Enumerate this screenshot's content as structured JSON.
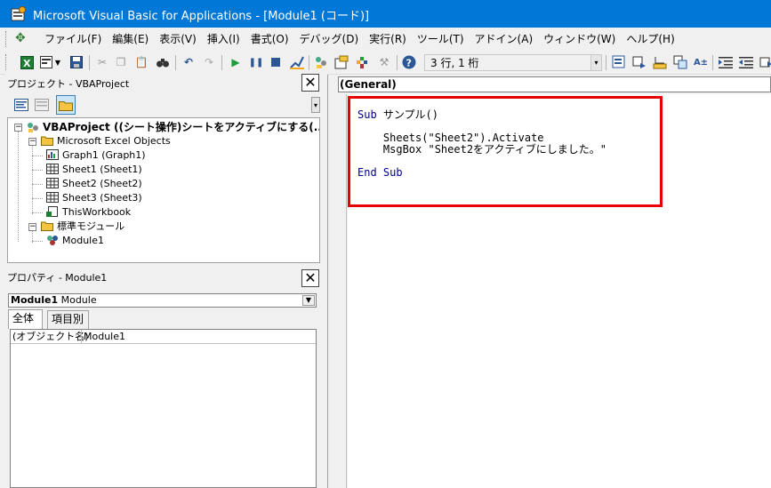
{
  "window": {
    "title": "Microsoft Visual Basic for Applications - [Module1 (コード)]"
  },
  "menu": {
    "items": [
      "ファイル(F)",
      "編集(E)",
      "表示(V)",
      "挿入(I)",
      "書式(O)",
      "デバッグ(D)",
      "実行(R)",
      "ツール(T)",
      "アドイン(A)",
      "ウィンドウ(W)",
      "ヘルプ(H)"
    ]
  },
  "toolbar": {
    "position": "3 行, 1 桁",
    "icons": [
      "excel-icon",
      "insert-userform-icon",
      "save-icon",
      "cut-icon",
      "copy-icon",
      "paste-icon",
      "find-icon",
      "undo-icon",
      "redo-icon",
      "run-icon",
      "break-icon",
      "reset-icon",
      "design-mode-icon",
      "project-explorer-icon",
      "properties-icon",
      "object-browser-icon",
      "toolbox-icon",
      "help-icon"
    ]
  },
  "project": {
    "title": "プロジェクト - VBAProject",
    "root": "VBAProject ((シート操作)シートをアクティブにする(...)",
    "folder_objects": "Microsoft Excel Objects",
    "items": [
      "Graph1 (Graph1)",
      "Sheet1 (Sheet1)",
      "Sheet2 (Sheet2)",
      "Sheet3 (Sheet3)",
      "ThisWorkbook"
    ],
    "folder_modules": "標準モジュール",
    "module": "Module1"
  },
  "properties": {
    "title": "プロパティ - Module1",
    "object_name": "Module1",
    "object_type": "Module",
    "tabs": [
      "全体",
      "項目別"
    ],
    "row_name": "(オブジェクト名)",
    "row_value": "Module1"
  },
  "code": {
    "object_box": "(General)",
    "line1_kw": "Sub",
    "line1_rest": " サンプル()",
    "line2": "    Sheets(\"Sheet2\").Activate",
    "line3": "    MsgBox \"Sheet2をアクティブにしました。\"",
    "line4": "End Sub"
  },
  "colors": {
    "titlebar": "#0078d7",
    "highlight": "#e60000",
    "keyword": "#00008b"
  }
}
